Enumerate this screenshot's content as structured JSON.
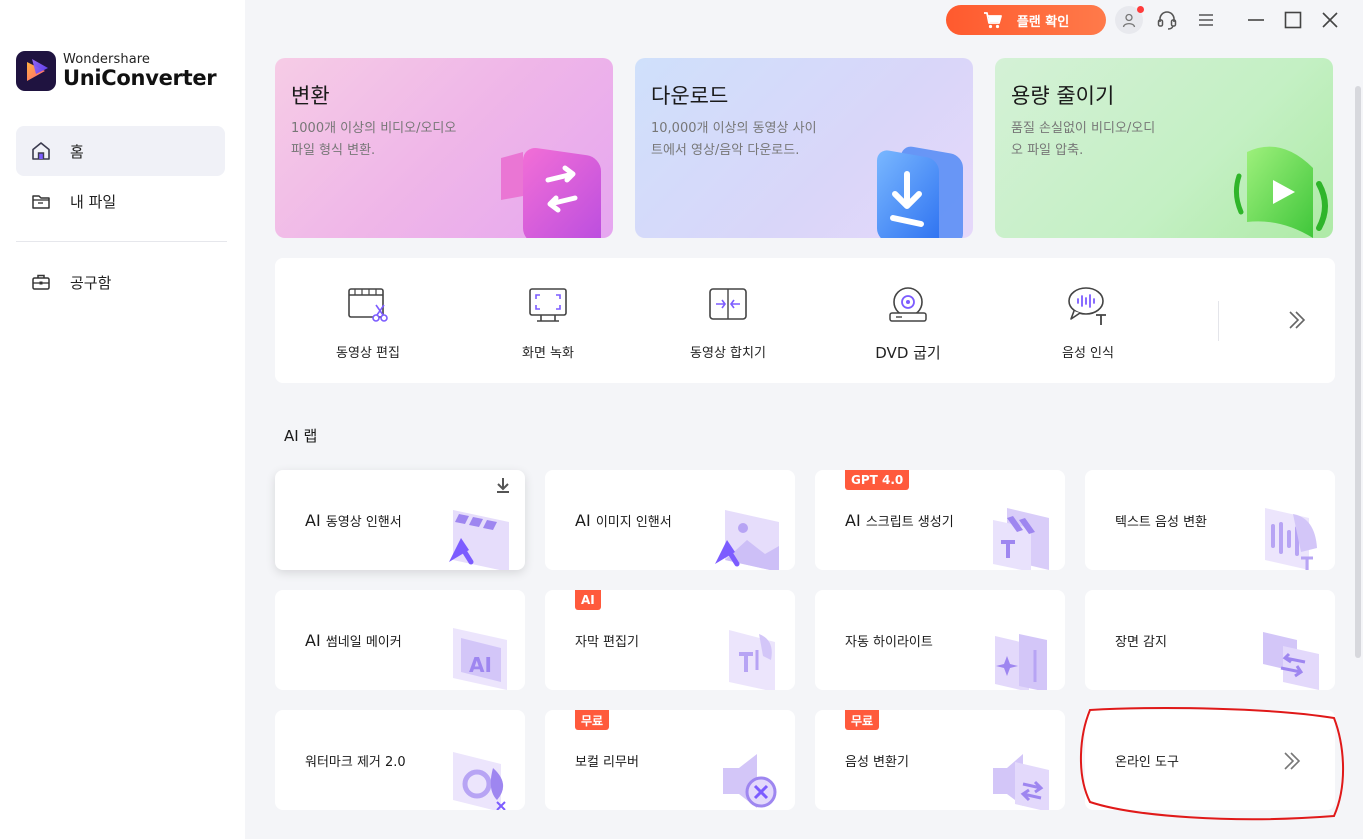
{
  "app": {
    "brand_sub": "Wondershare",
    "brand_main": "UniConverter"
  },
  "sidebar": {
    "items": [
      {
        "label": "홈",
        "icon": "home-icon"
      },
      {
        "label": "내 파일",
        "icon": "folder-icon"
      },
      {
        "label": "공구함",
        "icon": "toolbox-icon"
      }
    ]
  },
  "titlebar": {
    "plan_label": "플랜 확인",
    "colors": {
      "plan_button": "#ff5a2e",
      "notification_dot": "#ff3b3b"
    }
  },
  "feature_cards": [
    {
      "title": "변환",
      "desc": "1000개 이상의 비디오/오디오 파일 형식 변환.",
      "icon": "convert-icon"
    },
    {
      "title": "다운로드",
      "desc": "10,000개 이상의 동영상 사이트에서 영상/음악 다운로드.",
      "icon": "download-icon"
    },
    {
      "title": "용량 줄이기",
      "desc": "품질 손실없이 비디오/오디오 파일 압축.",
      "icon": "compress-icon"
    }
  ],
  "tools": [
    {
      "label": "동영상 편집",
      "icon": "video-edit-icon"
    },
    {
      "label": "화면 녹화",
      "icon": "screen-record-icon"
    },
    {
      "label": "동영상 합치기",
      "icon": "merge-icon"
    },
    {
      "label": "DVD 굽기",
      "icon": "dvd-burn-icon"
    },
    {
      "label": "음성 인식",
      "icon": "speech-recognition-icon"
    }
  ],
  "ai_lab": {
    "title": "AI 랩",
    "cards": [
      {
        "prefix": "AI",
        "label": "동영상 인핸서",
        "badge": "",
        "icon": "video-enhancer-icon"
      },
      {
        "prefix": "AI",
        "label": "이미지 인핸서",
        "badge": "",
        "icon": "image-enhancer-icon"
      },
      {
        "prefix": "AI",
        "label": "스크립트 생성기",
        "badge": "GPT 4.0",
        "icon": "script-icon"
      },
      {
        "prefix": "",
        "label": "텍스트 음성 변환",
        "badge": "",
        "icon": "tts-icon"
      },
      {
        "prefix": "AI",
        "label": "썸네일 메이커",
        "badge": "",
        "icon": "thumbnail-icon"
      },
      {
        "prefix": "",
        "label": "자막 편집기",
        "badge": "AI",
        "icon": "subtitle-icon"
      },
      {
        "prefix": "",
        "label": "자동 하이라이트",
        "badge": "",
        "icon": "highlight-icon"
      },
      {
        "prefix": "",
        "label": "장면 감지",
        "badge": "",
        "icon": "scene-detect-icon"
      },
      {
        "prefix": "",
        "label": "워터마크 제거 2.0",
        "badge": "",
        "icon": "watermark-icon"
      },
      {
        "prefix": "",
        "label": "보컬 리무버",
        "badge": "무료",
        "icon": "vocal-remover-icon"
      },
      {
        "prefix": "",
        "label": "음성 변환기",
        "badge": "무료",
        "icon": "voice-changer-icon"
      },
      {
        "prefix": "",
        "label": "온라인 도구",
        "badge": "",
        "icon": "chevron-double-right-icon"
      }
    ]
  }
}
